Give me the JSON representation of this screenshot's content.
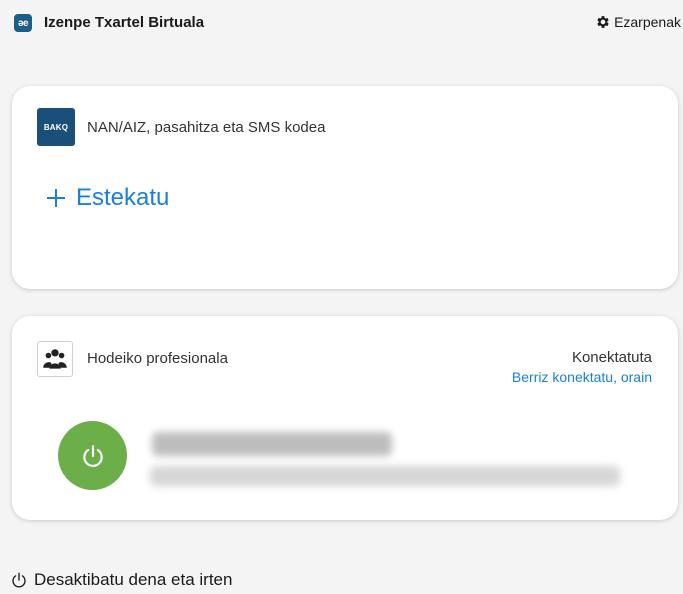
{
  "header": {
    "logo_text": "əe",
    "title": "Izenpe Txartel Birtuala",
    "settings_label": "Ezarpenak"
  },
  "providers": [
    {
      "icon_text": "BAKQ",
      "name": "NAN/AIZ, pasahitza eta SMS kodea",
      "link_label": "Estekatu"
    },
    {
      "name": "Hodeiko profesionala",
      "status": "Konektatuta",
      "reconnect_label": "Berriz konektatu, orain"
    }
  ],
  "footer": {
    "logout_label": "Desaktibatu dena eta irten"
  },
  "colors": {
    "accent": "#1a7fe0",
    "toggle_on": "#6cae4a",
    "bakq": "#1a4f7a",
    "logo": "#1d5e88"
  }
}
